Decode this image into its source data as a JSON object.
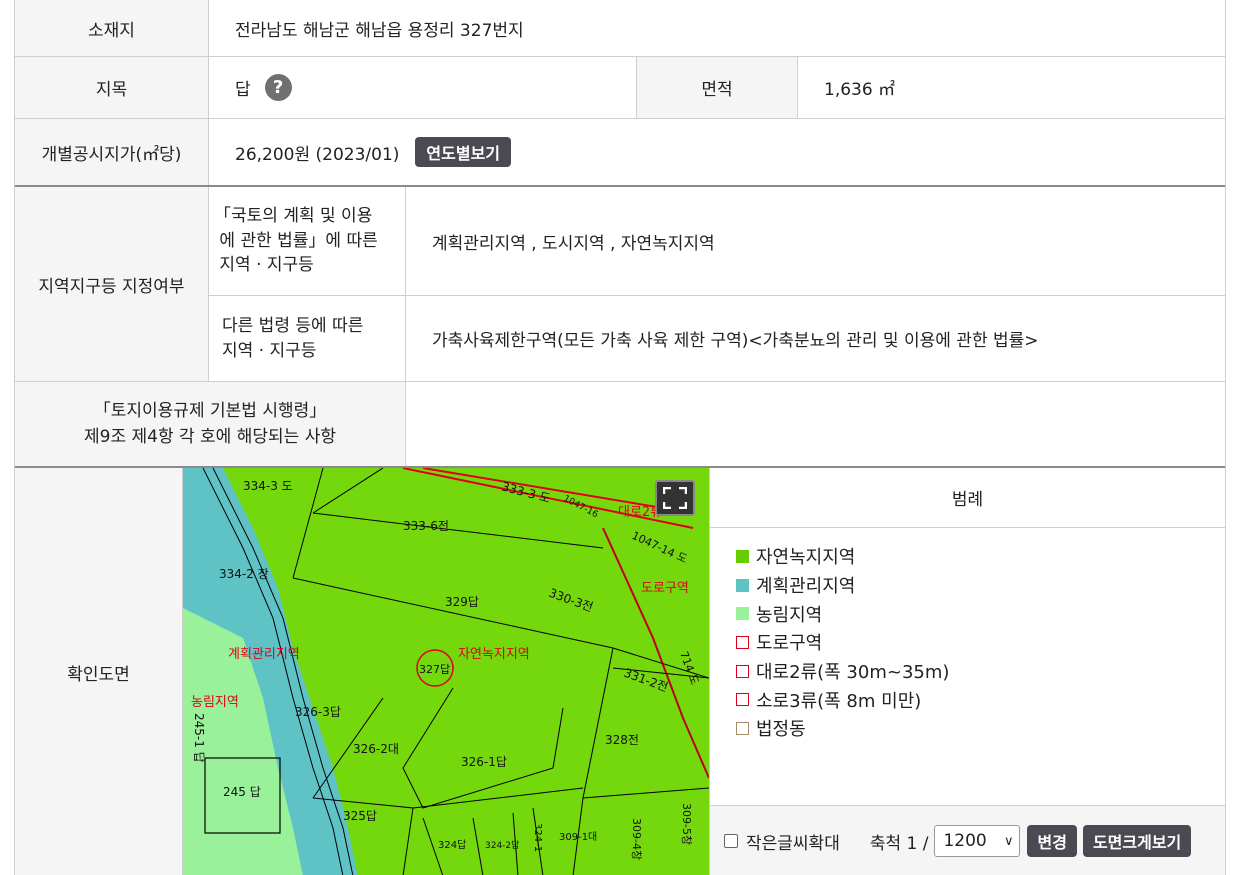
{
  "location": {
    "label": "소재지",
    "value": "전라남도 해남군 해남읍 용정리 327번지"
  },
  "land_category": {
    "label": "지목",
    "value": "답",
    "help_icon": "question-circle-icon"
  },
  "area": {
    "label": "면적",
    "value": "1,636 ㎡"
  },
  "official_price": {
    "label": "개별공시지가(㎡당)",
    "value": "26,200원 (2023/01)",
    "button_label": "연도별보기"
  },
  "zoning": {
    "label": "지역지구등 지정여부",
    "national_law": {
      "label_lines": [
        "「국토의 계획 및 이용",
        " 에 관한 법률」에 따른",
        " 지역 · 지구등"
      ],
      "value": "계획관리지역 , 도시지역 , 자연녹지지역"
    },
    "other_law": {
      "label_lines": [
        "다른 법령 등에 따른",
        "지역 · 지구등"
      ],
      "value": "가축사육제한구역(모든 가축 사육 제한 구역)<가축분뇨의 관리 및 이용에 관한 법률>"
    }
  },
  "regulation": {
    "label_lines": [
      "「토지이용규제 기본법 시행령」",
      "제9조 제4항 각 호에 해당되는 사항"
    ],
    "value": ""
  },
  "map_section": {
    "label": "확인도면",
    "fullscreen_icon": "fullscreen-icon",
    "parcel_labels": [
      "334-3 도",
      "333-6전",
      "334-2 창",
      "329답",
      "330-3전",
      "331-2전",
      "327답",
      "326-3답",
      "326-2대",
      "326-1답",
      "328전",
      "245 답",
      "325답",
      "324답",
      "324-2답",
      "324-1",
      "309-1대",
      "309-4창",
      "309-5창",
      "245-1 답",
      "333-3 도",
      "1047-14 도",
      "714 도",
      "1047-16"
    ],
    "zone_labels": [
      "계획관리지역",
      "자연녹지지역",
      "농림지역",
      "도로구역",
      "대로2류"
    ]
  },
  "legend": {
    "title": "범례",
    "items": [
      {
        "label": "자연녹지지역",
        "color": "#66cc00",
        "style": "fill"
      },
      {
        "label": "계획관리지역",
        "color": "#5fc3c6",
        "style": "fill"
      },
      {
        "label": "농림지역",
        "color": "#99f199",
        "style": "fill"
      },
      {
        "label": "도로구역",
        "color": "#e0001b",
        "style": "outline"
      },
      {
        "label": "대로2류(폭 30m~35m)",
        "color": "#e0001b",
        "style": "outline"
      },
      {
        "label": "소로3류(폭 8m 미만)",
        "color": "#e0001b",
        "style": "outline"
      },
      {
        "label": "법정동",
        "color": "#a08c6a",
        "style": "outline"
      }
    ]
  },
  "controls": {
    "enlarge_text_label": "작은글씨확대",
    "scale_label": "축척 1 /",
    "scale_value": "1200",
    "change_button": "변경",
    "enlarge_map_button": "도면크게보기"
  }
}
